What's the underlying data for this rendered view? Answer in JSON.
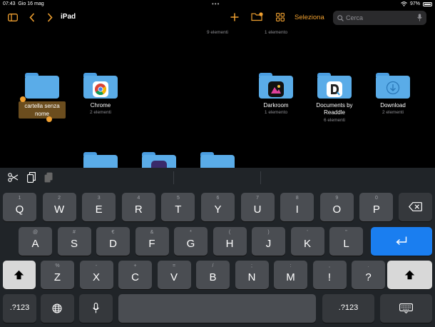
{
  "status": {
    "time": "07:43",
    "date": "Gio 16 mag",
    "battery": "97%"
  },
  "toolbar": {
    "title": "iPad",
    "select_label": "Seleziona",
    "search_placeholder": "Cerca"
  },
  "top_counts": [
    "9 elementi",
    "1 elemento"
  ],
  "rename": {
    "text": "cartella senza nome"
  },
  "folders": [
    {
      "name": "Chrome",
      "count": "2 elementi",
      "icon": "chrome-icon"
    },
    {
      "name": "Darkroom",
      "count": "1 elemento",
      "icon": "darkroom-icon"
    },
    {
      "name": "Documents by Readdle",
      "count": "6 elementi",
      "icon": "documents-icon"
    },
    {
      "name": "Download",
      "count": "2 elementi",
      "icon": "download-icon"
    }
  ],
  "keyboard": {
    "row1": [
      {
        "alt": "1",
        "key": "Q"
      },
      {
        "alt": "2",
        "key": "W"
      },
      {
        "alt": "3",
        "key": "E"
      },
      {
        "alt": "4",
        "key": "R"
      },
      {
        "alt": "5",
        "key": "T"
      },
      {
        "alt": "6",
        "key": "Y"
      },
      {
        "alt": "7",
        "key": "U"
      },
      {
        "alt": "8",
        "key": "I"
      },
      {
        "alt": "9",
        "key": "O"
      },
      {
        "alt": "0",
        "key": "P"
      }
    ],
    "row2": [
      {
        "alt": "@",
        "key": "A"
      },
      {
        "alt": "#",
        "key": "S"
      },
      {
        "alt": "€",
        "key": "D"
      },
      {
        "alt": "&",
        "key": "F"
      },
      {
        "alt": "*",
        "key": "G"
      },
      {
        "alt": "(",
        "key": "H"
      },
      {
        "alt": ")",
        "key": "J"
      },
      {
        "alt": "'",
        "key": "K"
      },
      {
        "alt": "\"",
        "key": "L"
      }
    ],
    "row3": [
      {
        "alt": "%",
        "key": "Z"
      },
      {
        "alt": "-",
        "key": "X"
      },
      {
        "alt": "+",
        "key": "C"
      },
      {
        "alt": "=",
        "key": "V"
      },
      {
        "alt": "/",
        "key": "B"
      },
      {
        "alt": ";",
        "key": "N"
      },
      {
        "alt": ":",
        "key": "M"
      },
      {
        "alt": ",",
        "key": "!"
      },
      {
        "alt": ".",
        "key": "?"
      }
    ],
    "numbers_label": ".?123"
  },
  "colors": {
    "accent": "#f0a030",
    "folder": "#5aace8",
    "return_key": "#1a7ef0"
  }
}
